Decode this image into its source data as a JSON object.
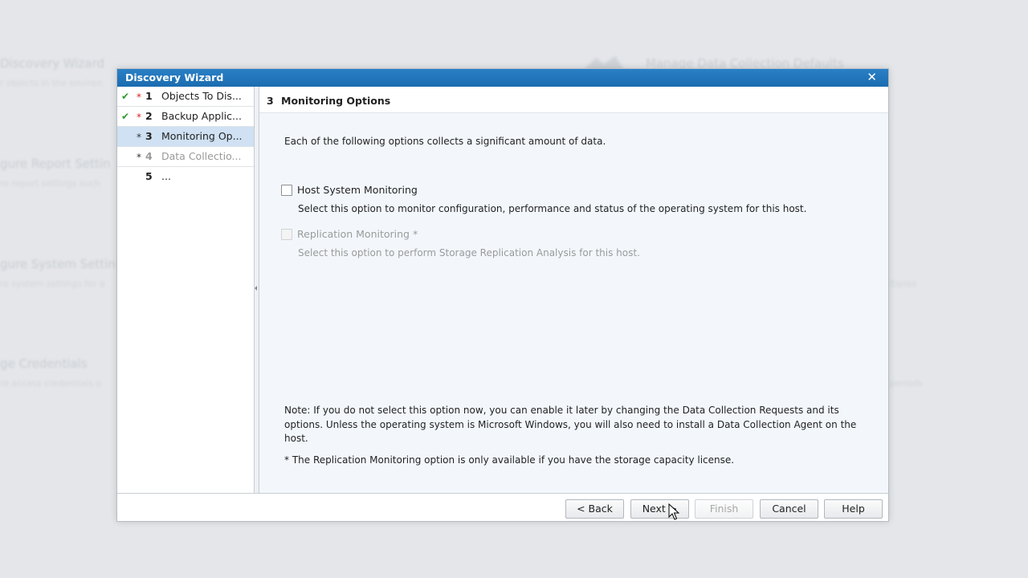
{
  "background": {
    "items": [
      {
        "title": "Discovery Wizard",
        "sub": "r objects in the environ"
      },
      {
        "title": "gure Report Settin",
        "sub": "re report settings such"
      },
      {
        "title": "gure System Settin",
        "sub": "re system settings for a"
      },
      {
        "title": "ge Credentials",
        "sub": "re access credentials o"
      }
    ],
    "right_title": "Manage Data Collection Defaults",
    "right_sub_1": "ltiples",
    "right_sub_2": "periods"
  },
  "dialog": {
    "title": "Discovery Wizard",
    "close_glyph": "✕",
    "steps": [
      {
        "check": "✔",
        "star": "*",
        "num": "1",
        "label": "Objects To Dis..."
      },
      {
        "check": "✔",
        "star": "*",
        "num": "2",
        "label": "Backup Applic..."
      },
      {
        "check": "",
        "star": "*",
        "num": "3",
        "label": "Monitoring Op..."
      },
      {
        "check": "",
        "star": "*",
        "num": "4",
        "label": "Data Collectio..."
      },
      {
        "check": "",
        "star": "",
        "num": "5",
        "label": "..."
      }
    ],
    "content": {
      "header_num": "3",
      "header_title": "Monitoring Options",
      "intro": "Each of the following options collects a significant amount of data.",
      "host_monitoring_label": "Host System Monitoring",
      "host_monitoring_desc": "Select this option to monitor configuration, performance and status of the operating system for this host.",
      "replication_label": "Replication Monitoring *",
      "replication_desc": "Select this option to perform Storage Replication Analysis for this host.",
      "note": "Note: If you do not select this option now, you can enable it later by changing the Data Collection Requests and its options. Unless the operating system is Microsoft Windows, you will also need to install a Data Collection Agent on the host.",
      "footnote": "* The Replication Monitoring option is only available if you have the storage capacity license."
    },
    "buttons": {
      "back": "< Back",
      "next": "Next >",
      "finish": "Finish",
      "cancel": "Cancel",
      "help": "Help"
    }
  }
}
